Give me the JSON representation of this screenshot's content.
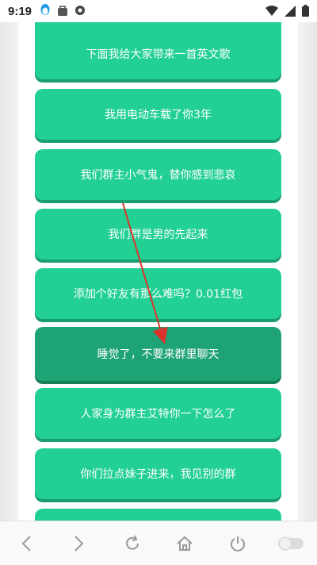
{
  "status_bar": {
    "time": "9:19",
    "icons_left": [
      "qq-penguin-icon",
      "bag-icon",
      "circle-badge-icon"
    ],
    "icons_right": [
      "wifi-icon",
      "signal-icon",
      "battery-icon"
    ]
  },
  "list": {
    "items": [
      "下面我给大家带来一首英文歌",
      "我用电动车载了你3年",
      "我们群主小气鬼，替你感到悲哀",
      "我们群是男的先起来",
      "添加个好友有那么难吗？0.01红包",
      "睡觉了，不要来群里聊天",
      "人家身为群主艾特你一下怎么了",
      "你们拉点妹子进来，我见别的群"
    ],
    "active_index": 5
  },
  "colors": {
    "button": "#22d094",
    "button_active": "#1ea374",
    "arrow": "#d9342b"
  },
  "bottom_nav": [
    "back-icon",
    "forward-icon",
    "refresh-icon",
    "home-icon",
    "power-icon",
    "toggle-icon"
  ]
}
